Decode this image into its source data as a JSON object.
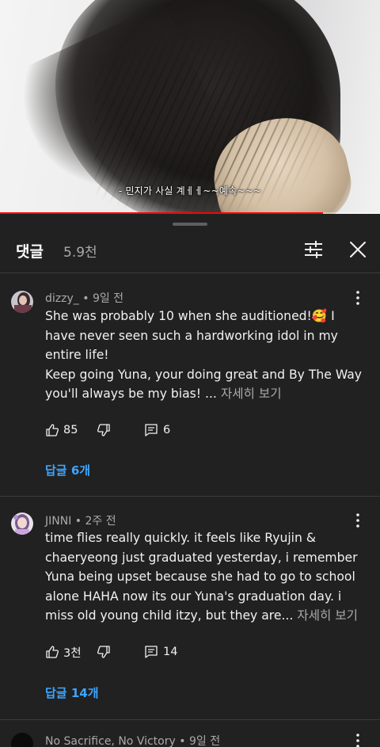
{
  "video": {
    "subtitle": "- 민지가 사실 계ㅔㅔ~~예속~~~",
    "progress": 0.85
  },
  "panel": {
    "title": "댓글",
    "count": "5.9천",
    "sort_icon": "sort-icon",
    "close_icon": "close-icon"
  },
  "comments": [
    {
      "author": "dizzy_",
      "time": "9일 전",
      "lines": [
        "She was probably 10 when she auditioned!🥰 I",
        "have never seen such a hardworking idol in my",
        "entire life!",
        "Keep going Yuna, your doing great and By The Way",
        "you'll always be my bias! ..."
      ],
      "read_more": "자세히 보기",
      "likes": "85",
      "reply_count": "6",
      "replies_label": "답글 6개"
    },
    {
      "author": "JINNI",
      "time": "2주 전",
      "lines": [
        "time flies really quickly. it feels like Ryujin &",
        "chaeryeong just graduated yesterday, i remember",
        "Yuna being upset because she had to go to school",
        "alone HAHA now its our Yuna's graduation day. i",
        "miss old young child itzy, but they are..."
      ],
      "read_more": "자세히 보기",
      "likes": "3천",
      "reply_count": "14",
      "replies_label": "답글 14개"
    },
    {
      "author": "No Sacrifice, No Victory",
      "time": "9일 전"
    }
  ],
  "colors": {
    "background": "#212121",
    "accent_link": "#3ea6ff",
    "progress": "#ff0000",
    "secondary_text": "#aaaaaa"
  }
}
